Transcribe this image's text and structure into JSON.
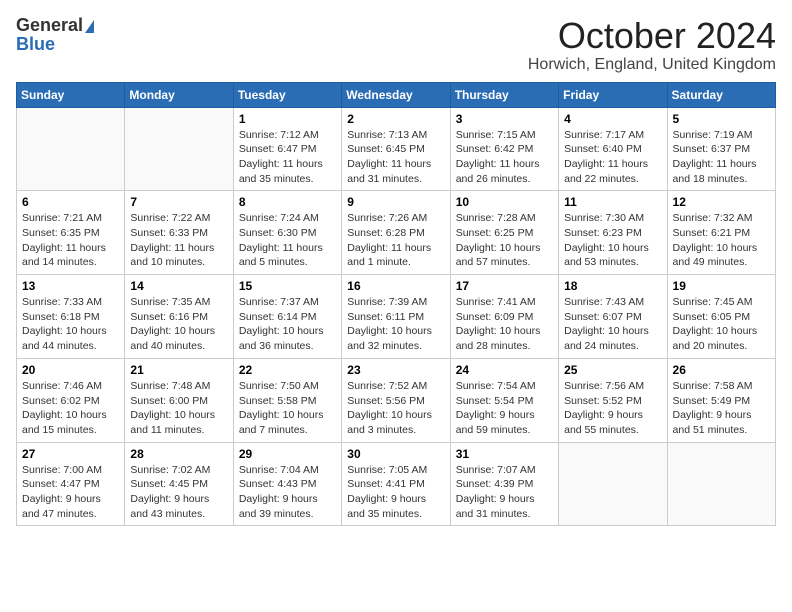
{
  "logo": {
    "general": "General",
    "blue": "Blue"
  },
  "title": "October 2024",
  "location": "Horwich, England, United Kingdom",
  "days": [
    "Sunday",
    "Monday",
    "Tuesday",
    "Wednesday",
    "Thursday",
    "Friday",
    "Saturday"
  ],
  "weeks": [
    [
      {
        "day": "",
        "sunrise": "",
        "sunset": "",
        "daylight": ""
      },
      {
        "day": "",
        "sunrise": "",
        "sunset": "",
        "daylight": ""
      },
      {
        "day": "1",
        "sunrise": "Sunrise: 7:12 AM",
        "sunset": "Sunset: 6:47 PM",
        "daylight": "Daylight: 11 hours and 35 minutes."
      },
      {
        "day": "2",
        "sunrise": "Sunrise: 7:13 AM",
        "sunset": "Sunset: 6:45 PM",
        "daylight": "Daylight: 11 hours and 31 minutes."
      },
      {
        "day": "3",
        "sunrise": "Sunrise: 7:15 AM",
        "sunset": "Sunset: 6:42 PM",
        "daylight": "Daylight: 11 hours and 26 minutes."
      },
      {
        "day": "4",
        "sunrise": "Sunrise: 7:17 AM",
        "sunset": "Sunset: 6:40 PM",
        "daylight": "Daylight: 11 hours and 22 minutes."
      },
      {
        "day": "5",
        "sunrise": "Sunrise: 7:19 AM",
        "sunset": "Sunset: 6:37 PM",
        "daylight": "Daylight: 11 hours and 18 minutes."
      }
    ],
    [
      {
        "day": "6",
        "sunrise": "Sunrise: 7:21 AM",
        "sunset": "Sunset: 6:35 PM",
        "daylight": "Daylight: 11 hours and 14 minutes."
      },
      {
        "day": "7",
        "sunrise": "Sunrise: 7:22 AM",
        "sunset": "Sunset: 6:33 PM",
        "daylight": "Daylight: 11 hours and 10 minutes."
      },
      {
        "day": "8",
        "sunrise": "Sunrise: 7:24 AM",
        "sunset": "Sunset: 6:30 PM",
        "daylight": "Daylight: 11 hours and 5 minutes."
      },
      {
        "day": "9",
        "sunrise": "Sunrise: 7:26 AM",
        "sunset": "Sunset: 6:28 PM",
        "daylight": "Daylight: 11 hours and 1 minute."
      },
      {
        "day": "10",
        "sunrise": "Sunrise: 7:28 AM",
        "sunset": "Sunset: 6:25 PM",
        "daylight": "Daylight: 10 hours and 57 minutes."
      },
      {
        "day": "11",
        "sunrise": "Sunrise: 7:30 AM",
        "sunset": "Sunset: 6:23 PM",
        "daylight": "Daylight: 10 hours and 53 minutes."
      },
      {
        "day": "12",
        "sunrise": "Sunrise: 7:32 AM",
        "sunset": "Sunset: 6:21 PM",
        "daylight": "Daylight: 10 hours and 49 minutes."
      }
    ],
    [
      {
        "day": "13",
        "sunrise": "Sunrise: 7:33 AM",
        "sunset": "Sunset: 6:18 PM",
        "daylight": "Daylight: 10 hours and 44 minutes."
      },
      {
        "day": "14",
        "sunrise": "Sunrise: 7:35 AM",
        "sunset": "Sunset: 6:16 PM",
        "daylight": "Daylight: 10 hours and 40 minutes."
      },
      {
        "day": "15",
        "sunrise": "Sunrise: 7:37 AM",
        "sunset": "Sunset: 6:14 PM",
        "daylight": "Daylight: 10 hours and 36 minutes."
      },
      {
        "day": "16",
        "sunrise": "Sunrise: 7:39 AM",
        "sunset": "Sunset: 6:11 PM",
        "daylight": "Daylight: 10 hours and 32 minutes."
      },
      {
        "day": "17",
        "sunrise": "Sunrise: 7:41 AM",
        "sunset": "Sunset: 6:09 PM",
        "daylight": "Daylight: 10 hours and 28 minutes."
      },
      {
        "day": "18",
        "sunrise": "Sunrise: 7:43 AM",
        "sunset": "Sunset: 6:07 PM",
        "daylight": "Daylight: 10 hours and 24 minutes."
      },
      {
        "day": "19",
        "sunrise": "Sunrise: 7:45 AM",
        "sunset": "Sunset: 6:05 PM",
        "daylight": "Daylight: 10 hours and 20 minutes."
      }
    ],
    [
      {
        "day": "20",
        "sunrise": "Sunrise: 7:46 AM",
        "sunset": "Sunset: 6:02 PM",
        "daylight": "Daylight: 10 hours and 15 minutes."
      },
      {
        "day": "21",
        "sunrise": "Sunrise: 7:48 AM",
        "sunset": "Sunset: 6:00 PM",
        "daylight": "Daylight: 10 hours and 11 minutes."
      },
      {
        "day": "22",
        "sunrise": "Sunrise: 7:50 AM",
        "sunset": "Sunset: 5:58 PM",
        "daylight": "Daylight: 10 hours and 7 minutes."
      },
      {
        "day": "23",
        "sunrise": "Sunrise: 7:52 AM",
        "sunset": "Sunset: 5:56 PM",
        "daylight": "Daylight: 10 hours and 3 minutes."
      },
      {
        "day": "24",
        "sunrise": "Sunrise: 7:54 AM",
        "sunset": "Sunset: 5:54 PM",
        "daylight": "Daylight: 9 hours and 59 minutes."
      },
      {
        "day": "25",
        "sunrise": "Sunrise: 7:56 AM",
        "sunset": "Sunset: 5:52 PM",
        "daylight": "Daylight: 9 hours and 55 minutes."
      },
      {
        "day": "26",
        "sunrise": "Sunrise: 7:58 AM",
        "sunset": "Sunset: 5:49 PM",
        "daylight": "Daylight: 9 hours and 51 minutes."
      }
    ],
    [
      {
        "day": "27",
        "sunrise": "Sunrise: 7:00 AM",
        "sunset": "Sunset: 4:47 PM",
        "daylight": "Daylight: 9 hours and 47 minutes."
      },
      {
        "day": "28",
        "sunrise": "Sunrise: 7:02 AM",
        "sunset": "Sunset: 4:45 PM",
        "daylight": "Daylight: 9 hours and 43 minutes."
      },
      {
        "day": "29",
        "sunrise": "Sunrise: 7:04 AM",
        "sunset": "Sunset: 4:43 PM",
        "daylight": "Daylight: 9 hours and 39 minutes."
      },
      {
        "day": "30",
        "sunrise": "Sunrise: 7:05 AM",
        "sunset": "Sunset: 4:41 PM",
        "daylight": "Daylight: 9 hours and 35 minutes."
      },
      {
        "day": "31",
        "sunrise": "Sunrise: 7:07 AM",
        "sunset": "Sunset: 4:39 PM",
        "daylight": "Daylight: 9 hours and 31 minutes."
      },
      {
        "day": "",
        "sunrise": "",
        "sunset": "",
        "daylight": ""
      },
      {
        "day": "",
        "sunrise": "",
        "sunset": "",
        "daylight": ""
      }
    ]
  ]
}
